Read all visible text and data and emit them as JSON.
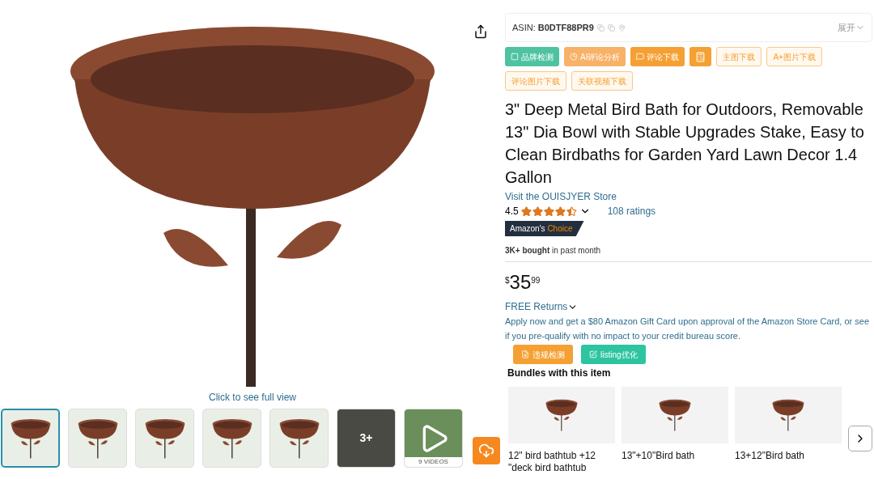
{
  "gallery": {
    "caption": "Click to see full view",
    "thumbnails": [
      {
        "kind": "photo",
        "selected": true
      },
      {
        "kind": "photo",
        "selected": false
      },
      {
        "kind": "photo",
        "selected": false
      },
      {
        "kind": "photo",
        "selected": false
      },
      {
        "kind": "photo",
        "selected": false
      },
      {
        "kind": "more",
        "selected": false,
        "count": "3+"
      },
      {
        "kind": "video",
        "selected": false,
        "label": "9 VIDEOS"
      }
    ]
  },
  "plugin": {
    "asin_label": "ASIN:",
    "asin": "B0DTF88PR9",
    "expand": "展开",
    "buttons": [
      {
        "kind": "green",
        "label": "品牌检测"
      },
      {
        "kind": "orange-light",
        "label": "AI评论分析"
      },
      {
        "kind": "orange",
        "label": "评论下载"
      },
      {
        "kind": "orange"
      },
      {
        "kind": "outline",
        "label": "主图下载"
      },
      {
        "kind": "outline",
        "label": "A+图片下载"
      },
      {
        "kind": "outline",
        "label": "评论图片下载"
      },
      {
        "kind": "outline",
        "label": "关联视频下载"
      }
    ]
  },
  "product": {
    "title": "3\" Deep Metal Bird Bath for Outdoors, Removable 13\" Dia Bowl with Stable Upgrades Stake, Easy to Clean Birdbaths for Garden Yard Lawn Decor 1.4 Gallon",
    "store": "Visit the OUISJYER Store",
    "rating": "4.5",
    "stars": 4.5,
    "ratings": "108 ratings",
    "badge": "Amazon's **Choice**",
    "bought": "**3K+ bought** in past month",
    "price_symbol": "$",
    "price_whole": "35",
    "price_fraction": "99",
    "returns": "FREE Returns",
    "offer": "Apply now and get a $80 Amazon Gift Card upon approval of the Amazon Store Card, or see if you pre-qualify with no impact to your credit bureau score.",
    "tools": [
      {
        "kind": "orange",
        "label": "违规检测"
      },
      {
        "kind": "green",
        "label": "listing优化"
      }
    ]
  },
  "bundles": {
    "heading": "Bundles with this item",
    "items": [
      {
        "label": "12\" bird bathtub +12 \"deck bird bathtub"
      },
      {
        "label": "13\"+10\"Bird bath"
      },
      {
        "label": "13+12\"Bird bath"
      }
    ]
  }
}
